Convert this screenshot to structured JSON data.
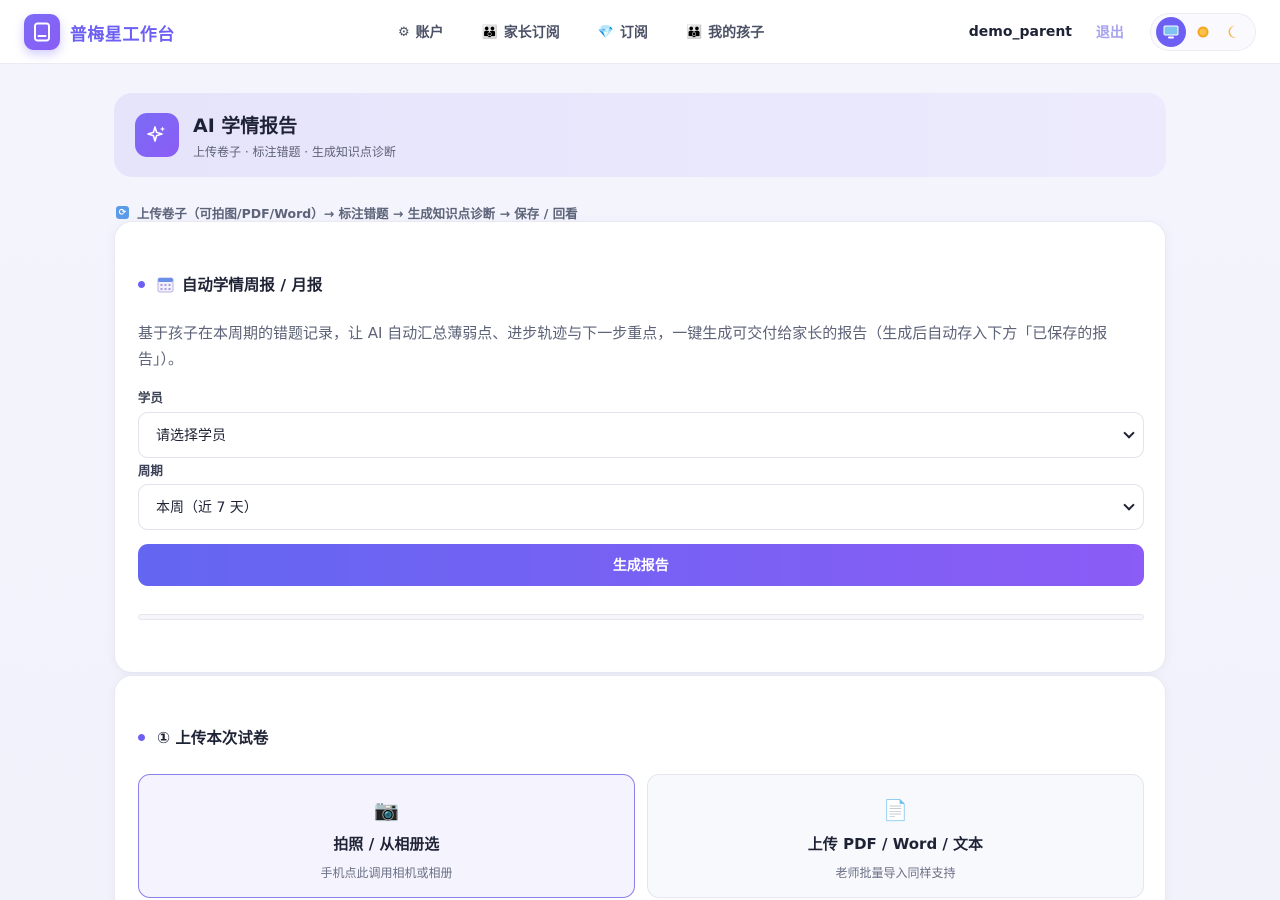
{
  "brand": {
    "name": "普梅星工作台"
  },
  "nav": {
    "items": [
      {
        "icon": "⚙",
        "label": "账户"
      },
      {
        "icon": "👪",
        "label": "家长订阅"
      },
      {
        "icon": "💎",
        "label": "订阅"
      },
      {
        "icon": "👪",
        "label": "我的孩子"
      }
    ]
  },
  "user": {
    "name": "demo_parent",
    "logout": "退出"
  },
  "theme": {
    "options": [
      "system-icon",
      "sun-icon",
      "moon-icon"
    ],
    "selected": "system"
  },
  "hero": {
    "title": "AI 学情报告",
    "subtitle": "上传卷子 · 标注错题 · 生成知识点诊断"
  },
  "flow": {
    "text": "上传卷子（可拍图/PDF/Word）→ 标注错题 → 生成知识点诊断 → 保存 / 回看"
  },
  "report": {
    "title": "自动学情周报 / 月报",
    "description": "基于孩子在本周期的错题记录，让 AI 自动汇总薄弱点、进步轨迹与下一步重点，一键生成可交付给家长的报告（生成后自动存入下方「已保存的报告」）。",
    "student_label": "学员",
    "student_value": "请选择学员",
    "period_label": "周期",
    "period_value": "本周（近 7 天）",
    "generate_label": "生成报告",
    "progress": 0
  },
  "upload": {
    "title": "① 上传本次试卷",
    "options": [
      {
        "icon": "📷",
        "title": "拍照 / 从相册选",
        "subtitle": "手机点此调用相机或相册"
      },
      {
        "icon": "📄",
        "title": "上传 PDF / Word / 文本",
        "subtitle": "老师批量导入同样支持"
      }
    ]
  },
  "colors": {
    "accent": "#6d5ff3",
    "button_start": "#6366f1",
    "button_end": "#8b5cf6"
  }
}
